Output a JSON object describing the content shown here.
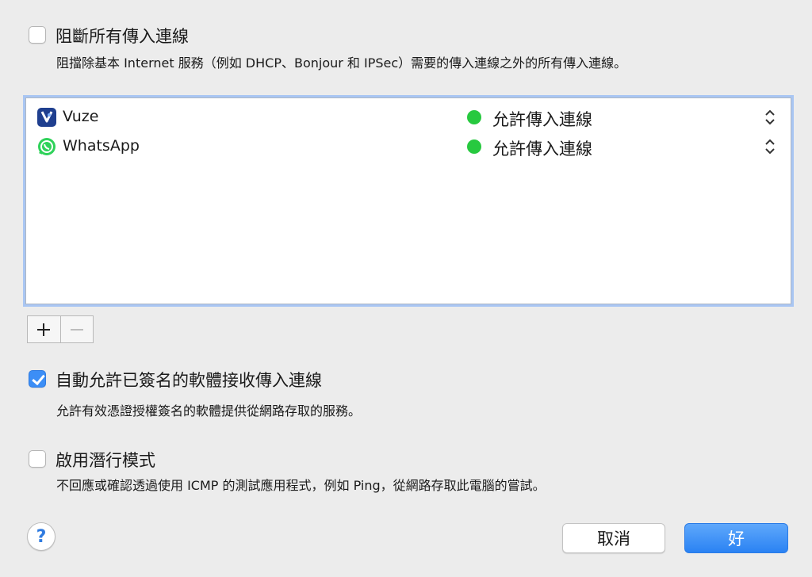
{
  "block_all": {
    "checked": false,
    "title": "阻斷所有傳入連線",
    "description": "阻擋除基本 Internet 服務（例如 DHCP、Bonjour 和 IPSec）需要的傳入連線之外的所有傳入連線。"
  },
  "apps": [
    {
      "name": "Vuze",
      "icon": "vuze-icon",
      "status": "允許傳入連線",
      "status_color": "#27c93f"
    },
    {
      "name": "WhatsApp",
      "icon": "whatsapp-icon",
      "status": "允許傳入連線",
      "status_color": "#27c93f"
    }
  ],
  "list_controls": {
    "add": "+",
    "remove": "−"
  },
  "auto_allow": {
    "checked": true,
    "title": "自動允許已簽名的軟體接收傳入連線",
    "description": "允許有效憑證授權簽名的軟體提供從網路存取的服務。"
  },
  "stealth": {
    "checked": false,
    "title": "啟用潛行模式",
    "description": "不回應或確認透過使用 ICMP 的測試應用程式，例如 Ping，從網路存取此電腦的嘗試。"
  },
  "footer": {
    "help": "?",
    "cancel": "取消",
    "ok": "好"
  },
  "colors": {
    "accent": "#3c8ef6",
    "allow_green": "#27c93f"
  }
}
